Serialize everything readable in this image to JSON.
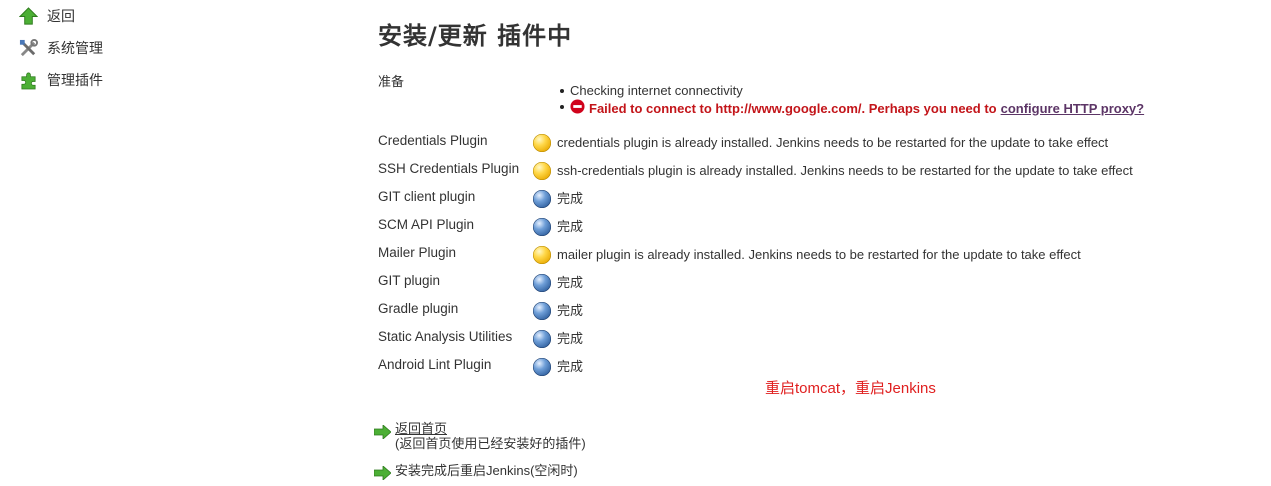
{
  "sidebar": {
    "items": [
      {
        "label": "返回",
        "icon": "up-arrow-icon"
      },
      {
        "label": "系统管理",
        "icon": "tools-icon"
      },
      {
        "label": "管理插件",
        "icon": "puzzle-icon"
      }
    ]
  },
  "page": {
    "title": "安装/更新 插件中"
  },
  "preparation": {
    "label": "准备",
    "items": [
      "Checking internet connectivity"
    ],
    "error": {
      "text": "Failed to connect to http://www.google.com/. Perhaps you need to",
      "link": "configure HTTP proxy?"
    }
  },
  "plugins": [
    {
      "name": "Credentials Plugin",
      "status": "credentials plugin is already installed. Jenkins needs to be restarted for the update to take effect",
      "state": "yellow"
    },
    {
      "name": "SSH Credentials Plugin",
      "status": "ssh-credentials plugin is already installed. Jenkins needs to be restarted for the update to take effect",
      "state": "yellow"
    },
    {
      "name": "GIT client plugin",
      "status": "完成",
      "state": "blue"
    },
    {
      "name": "SCM API Plugin",
      "status": "完成",
      "state": "blue"
    },
    {
      "name": "Mailer Plugin",
      "status": "mailer plugin is already installed. Jenkins needs to be restarted for the update to take effect",
      "state": "yellow"
    },
    {
      "name": "GIT plugin",
      "status": "完成",
      "state": "blue"
    },
    {
      "name": "Gradle plugin",
      "status": "完成",
      "state": "blue"
    },
    {
      "name": "Static Analysis Utilities",
      "status": "完成",
      "state": "blue"
    },
    {
      "name": "Android Lint Plugin",
      "status": "完成",
      "state": "blue"
    }
  ],
  "annotation": "重启tomcat，重启Jenkins",
  "actions": {
    "back_home": "返回首页",
    "back_home_note": "(返回首页使用已经安装好的插件)",
    "restart": "安装完成后重启Jenkins(空闲时)"
  },
  "colors": {
    "error": "#c3151a",
    "annotation": "#e02020",
    "success_ball": "blue",
    "pending_ball": "yellow"
  }
}
